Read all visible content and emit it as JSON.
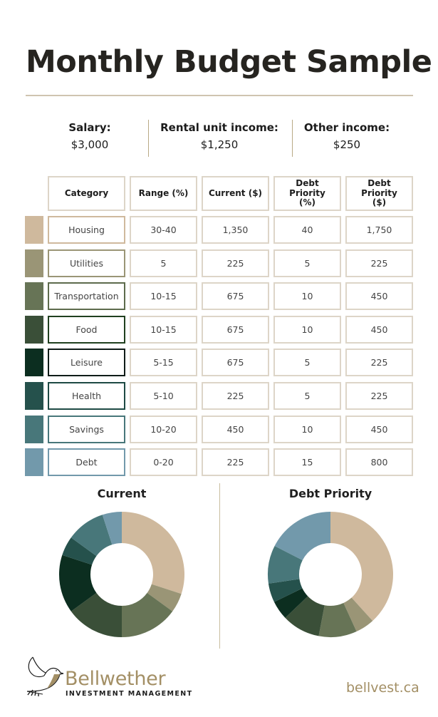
{
  "title": "Monthly Budget Sample",
  "income": [
    {
      "label": "Salary:",
      "value": "$3,000"
    },
    {
      "label": "Rental unit income:",
      "value": "$1,250"
    },
    {
      "label": "Other income:",
      "value": "$250"
    }
  ],
  "table": {
    "headers": [
      "Category",
      "Range (%)",
      "Current ($)",
      "Debt Priority (%)",
      "Debt Priority ($)"
    ],
    "rows": [
      {
        "category": "Housing",
        "range": "30-40",
        "current": "1,350",
        "debt_pct": "40",
        "debt_usd": "1,750",
        "color": "#cfb99d",
        "border": "#cfb99d"
      },
      {
        "category": "Utilities",
        "range": "5",
        "current": "225",
        "debt_pct": "5",
        "debt_usd": "225",
        "color": "#9a9576",
        "border": "#9a9576"
      },
      {
        "category": "Transportation",
        "range": "10-15",
        "current": "675",
        "debt_pct": "10",
        "debt_usd": "450",
        "color": "#677456",
        "border": "#5d6b4c"
      },
      {
        "category": "Food",
        "range": "10-15",
        "current": "675",
        "debt_pct": "10",
        "debt_usd": "450",
        "color": "#3a4f38",
        "border": "#20401f"
      },
      {
        "category": "Leisure",
        "range": "5-15",
        "current": "675",
        "debt_pct": "5",
        "debt_usd": "225",
        "color": "#0c2e20",
        "border": "#0f1c18"
      },
      {
        "category": "Health",
        "range": "5-10",
        "current": "225",
        "debt_pct": "5",
        "debt_usd": "225",
        "color": "#25514c",
        "border": "#1e4a44"
      },
      {
        "category": "Savings",
        "range": "10-20",
        "current": "450",
        "debt_pct": "10",
        "debt_usd": "450",
        "color": "#48777a",
        "border": "#48777a"
      },
      {
        "category": "Debt",
        "range": "0-20",
        "current": "225",
        "debt_pct": "15",
        "debt_usd": "800",
        "color": "#7299ab",
        "border": "#7299ab"
      }
    ]
  },
  "chart_data": [
    {
      "type": "pie",
      "title": "Current",
      "donut": true,
      "categories": [
        "Housing",
        "Utilities",
        "Transportation",
        "Food",
        "Leisure",
        "Health",
        "Savings",
        "Debt"
      ],
      "values": [
        1350,
        225,
        675,
        675,
        675,
        225,
        450,
        225
      ],
      "colors": [
        "#cfb99d",
        "#9a9576",
        "#677456",
        "#3a4f38",
        "#0c2e20",
        "#25514c",
        "#48777a",
        "#7299ab"
      ],
      "start": "top",
      "direction": "clockwise",
      "legend": "none"
    },
    {
      "type": "pie",
      "title": "Debt Priority",
      "donut": true,
      "categories": [
        "Housing",
        "Utilities",
        "Transportation",
        "Food",
        "Leisure",
        "Health",
        "Savings",
        "Debt"
      ],
      "values": [
        1750,
        225,
        450,
        450,
        225,
        225,
        450,
        800
      ],
      "colors": [
        "#cfb99d",
        "#9a9576",
        "#677456",
        "#3a4f38",
        "#0c2e20",
        "#25514c",
        "#48777a",
        "#7299ab"
      ],
      "start": "top",
      "direction": "clockwise",
      "legend": "none"
    }
  ],
  "footer": {
    "brand": "Bellwether",
    "brand_sub": "INVESTMENT MANAGEMENT",
    "logo_icon": "dove-icon",
    "website": "bellvest.ca",
    "accent": "#a38f65"
  }
}
